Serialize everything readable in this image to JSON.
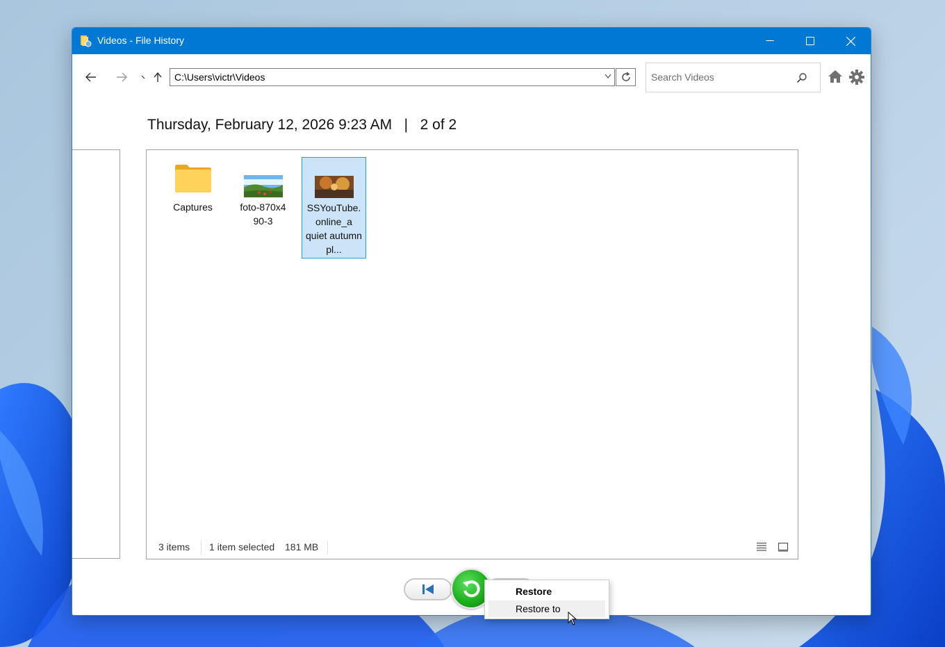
{
  "window": {
    "title": "Videos - File History",
    "accent_color": "#0078d4"
  },
  "toolbar": {
    "address": "C:\\Users\\victr\\Videos",
    "search_placeholder": "Search Videos"
  },
  "header": {
    "date": "Thursday, February 12, 2026 9:23 AM",
    "separator": "|",
    "position": "2 of 2"
  },
  "items": [
    {
      "name": "Captures",
      "icon": "folder-icon"
    },
    {
      "name": "foto-870x4 90-3",
      "icon": "image-thumbnail"
    },
    {
      "name": "SSYouTube. online_a quiet autumn pl...",
      "icon": "video-thumbnail",
      "selected": true
    }
  ],
  "status": {
    "count": "3 items",
    "selected": "1 item selected",
    "size": "181 MB"
  },
  "context_menu": {
    "items": [
      "Restore",
      "Restore to"
    ]
  },
  "colors": {
    "selection_bg": "#cce4f7",
    "selection_border": "#26a0da",
    "restore_green": "#1fb11f"
  }
}
